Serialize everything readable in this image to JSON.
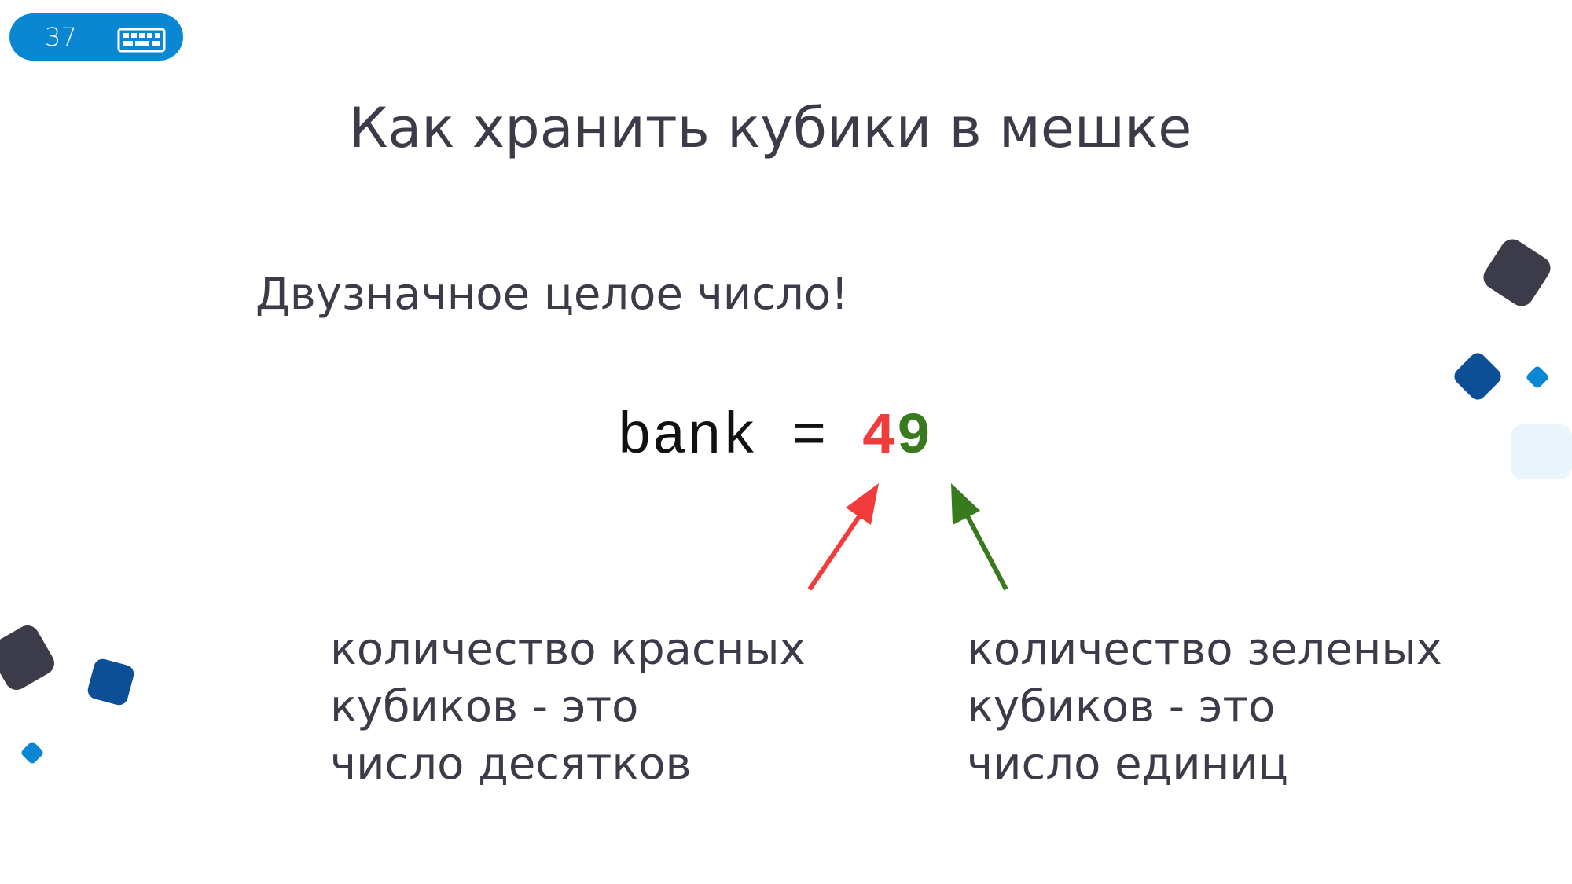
{
  "slide": {
    "number": "37",
    "title": "Как хранить кубики в мешке",
    "subtitle": "Двузначное целое число!"
  },
  "code": {
    "prefix": "bank = ",
    "tens_digit": "4",
    "ones_digit": "9"
  },
  "notes": {
    "left": [
      "количество красных",
      "кубиков - это",
      "число десятков"
    ],
    "right": [
      "количество зеленых",
      "кубиков - это",
      "число единиц"
    ]
  },
  "colors": {
    "accent_blue": "#0a87d2",
    "dark": "#3b3b4a",
    "navy": "#0d4f96",
    "red": "#f23c3c",
    "green": "#3a7a1e",
    "light": "#e9f4fb"
  },
  "icons": {
    "badge": "keyboard-icon"
  }
}
